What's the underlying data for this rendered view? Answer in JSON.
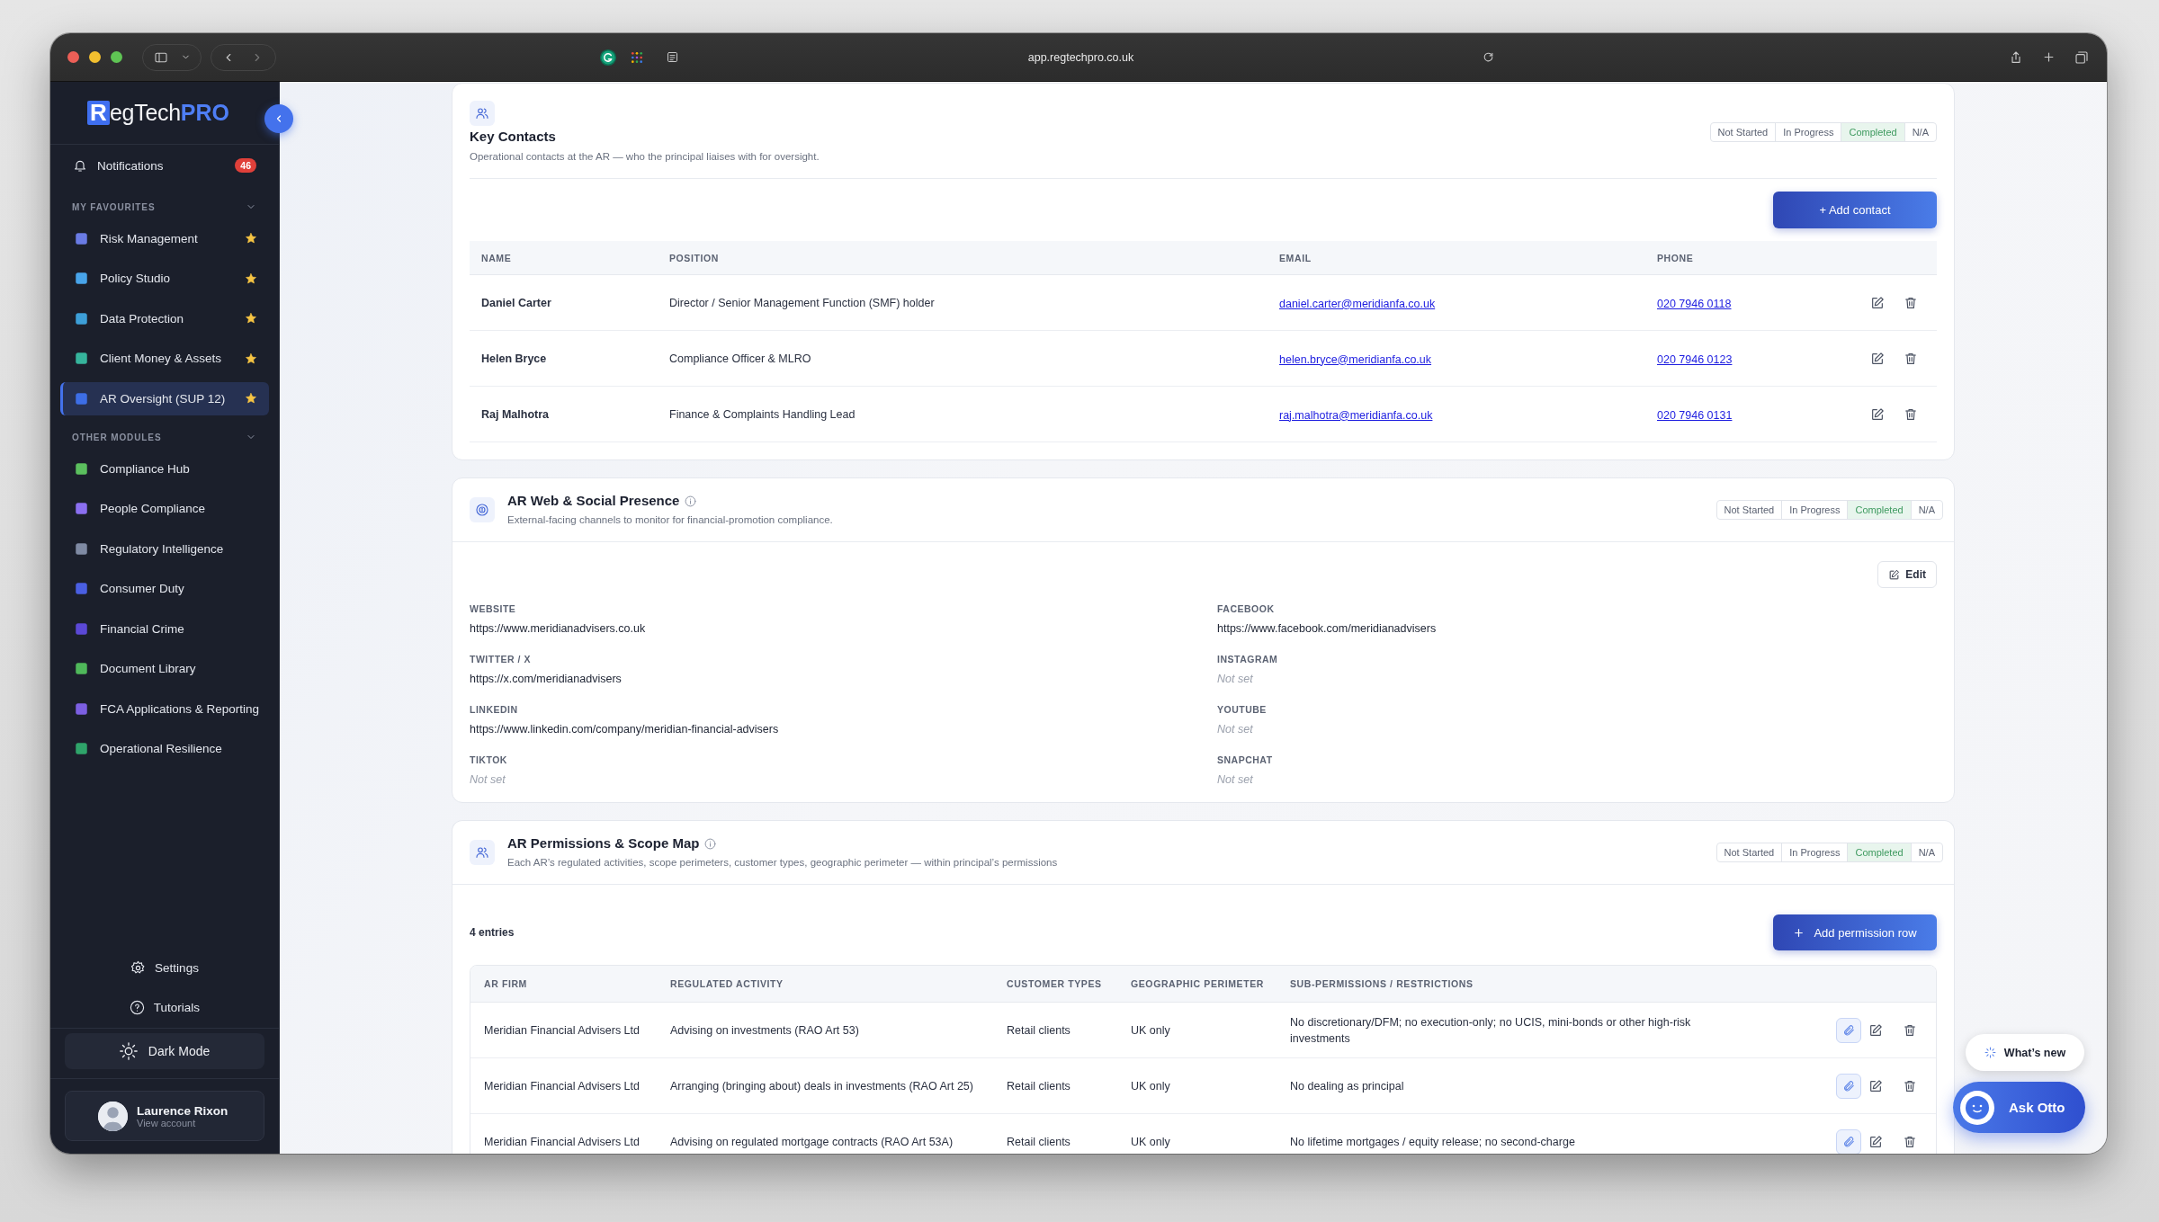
{
  "browser": {
    "url": "app.regtechpro.co.uk"
  },
  "sidebar": {
    "logo": {
      "initial": "R",
      "name": "egTech",
      "accent": "PRO"
    },
    "notifications": {
      "label": "Notifications",
      "count": "46"
    },
    "groups": [
      {
        "heading": "MY FAVOURITES",
        "expanded": true,
        "items": [
          {
            "label": "Risk Management",
            "color": "#6a7be4",
            "starred": true,
            "selected": false
          },
          {
            "label": "Policy Studio",
            "color": "#48a4ea",
            "starred": true,
            "selected": false
          },
          {
            "label": "Data Protection",
            "color": "#3d9fd8",
            "starred": true,
            "selected": false
          },
          {
            "label": "Client Money & Assets",
            "color": "#36b49c",
            "starred": true,
            "selected": false
          },
          {
            "label": "AR Oversight (SUP 12)",
            "color": "#3d6ee6",
            "starred": true,
            "selected": true
          }
        ]
      },
      {
        "heading": "OTHER MODULES",
        "expanded": true,
        "items": [
          {
            "label": "Compliance Hub",
            "color": "#5bbf5e",
            "starred": false,
            "selected": false
          },
          {
            "label": "People Compliance",
            "color": "#8b6ff0",
            "starred": false,
            "selected": false
          },
          {
            "label": "Regulatory Intelligence",
            "color": "#7f8aa3",
            "starred": false,
            "selected": false
          },
          {
            "label": "Consumer Duty",
            "color": "#4a5fe2",
            "starred": false,
            "selected": false
          },
          {
            "label": "Financial Crime",
            "color": "#5b48d6",
            "starred": false,
            "selected": false
          },
          {
            "label": "Document Library",
            "color": "#4fb85a",
            "starred": false,
            "selected": false
          },
          {
            "label": "FCA Applications & Reporting",
            "color": "#7c5fe2",
            "starred": false,
            "selected": false
          },
          {
            "label": "Operational Resilience",
            "color": "#2fa46a",
            "starred": false,
            "selected": false
          }
        ]
      }
    ],
    "footer": [
      {
        "label": "Settings",
        "kind": "settings"
      },
      {
        "label": "Tutorials",
        "kind": "help"
      }
    ],
    "dark_mode": {
      "label": "Dark Mode"
    },
    "user": {
      "name": "Laurence Rixon",
      "subtitle": "View account"
    }
  },
  "key_contacts": {
    "title": "Key Contacts",
    "subtitle": "Operational contacts at the AR — who the principal liaises with for oversight.",
    "status": [
      {
        "label": "Not Started",
        "selected": false
      },
      {
        "label": "In Progress",
        "selected": false
      },
      {
        "label": "Completed",
        "selected": true
      },
      {
        "label": "N/A",
        "selected": false
      }
    ],
    "add_button": "+ Add contact",
    "columns": [
      "NAME",
      "POSITION",
      "EMAIL",
      "PHONE"
    ],
    "rows": [
      {
        "name": "Daniel Carter",
        "position": "Director / Senior Management Function (SMF) holder",
        "email": "daniel.carter@meridianfa.co.uk",
        "phone": "020 7946 0118"
      },
      {
        "name": "Helen Bryce",
        "position": "Compliance Officer & MLRO",
        "email": "helen.bryce@meridianfa.co.uk",
        "phone": "020 7946 0123"
      },
      {
        "name": "Raj Malhotra",
        "position": "Finance & Complaints Handling Lead",
        "email": "raj.malhotra@meridianfa.co.uk",
        "phone": "020 7946 0131"
      }
    ]
  },
  "web_presence": {
    "title": "AR Web & Social Presence",
    "subtitle": "External-facing channels to monitor for financial-promotion compliance.",
    "status": [
      {
        "label": "Not Started",
        "selected": false
      },
      {
        "label": "In Progress",
        "selected": false
      },
      {
        "label": "Completed",
        "selected": true
      },
      {
        "label": "N/A",
        "selected": false
      }
    ],
    "edit_button": "Edit",
    "fields": [
      {
        "label": "WEBSITE",
        "value": "https://www.meridianadvisers.co.uk",
        "empty": false
      },
      {
        "label": "FACEBOOK",
        "value": "https://www.facebook.com/meridianadvisers",
        "empty": false
      },
      {
        "label": "TWITTER / X",
        "value": "https://x.com/meridianadvisers",
        "empty": false
      },
      {
        "label": "INSTAGRAM",
        "value": "Not set",
        "empty": true
      },
      {
        "label": "LINKEDIN",
        "value": "https://www.linkedin.com/company/meridian-financial-advisers",
        "empty": false
      },
      {
        "label": "YOUTUBE",
        "value": "Not set",
        "empty": true
      },
      {
        "label": "TIKTOK",
        "value": "Not set",
        "empty": true
      },
      {
        "label": "SNAPCHAT",
        "value": "Not set",
        "empty": true
      }
    ]
  },
  "permissions": {
    "title": "AR Permissions & Scope Map",
    "subtitle": "Each AR’s regulated activities, scope perimeters, customer types, geographic perimeter — within principal’s permissions",
    "status": [
      {
        "label": "Not Started",
        "selected": false
      },
      {
        "label": "In Progress",
        "selected": false
      },
      {
        "label": "Completed",
        "selected": true
      },
      {
        "label": "N/A",
        "selected": false
      }
    ],
    "count": "4 entries",
    "add_button": "Add permission row",
    "columns": [
      "AR FIRM",
      "REGULATED ACTIVITY",
      "CUSTOMER TYPES",
      "GEOGRAPHIC PERIMETER",
      "SUB-PERMISSIONS / RESTRICTIONS"
    ],
    "rows": [
      {
        "firm": "Meridian Financial Advisers Ltd",
        "activity": "Advising on investments (RAO Art 53)",
        "customers": "Retail clients",
        "perimeter": "UK only",
        "restrictions": "No discretionary/DFM; no execution-only; no UCIS, mini-bonds or other high-risk investments"
      },
      {
        "firm": "Meridian Financial Advisers Ltd",
        "activity": "Arranging (bringing about) deals in investments (RAO Art 25)",
        "customers": "Retail clients",
        "perimeter": "UK only",
        "restrictions": "No dealing as principal"
      },
      {
        "firm": "Meridian Financial Advisers Ltd",
        "activity": "Advising on regulated mortgage contracts (RAO Art 53A)",
        "customers": "Retail clients",
        "perimeter": "UK only",
        "restrictions": "No lifetime mortgages / equity release; no second-charge"
      }
    ]
  },
  "floating": {
    "whats_new": "What’s new",
    "assistant": "Ask Otto"
  }
}
